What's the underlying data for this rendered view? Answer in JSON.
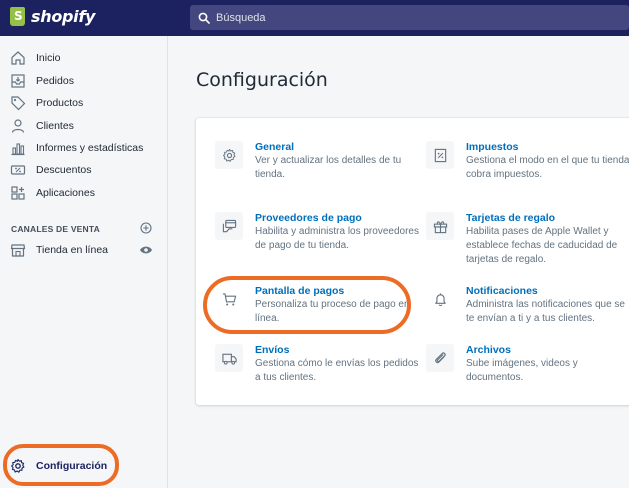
{
  "header": {
    "brand": "shopify",
    "search_placeholder": "Búsqueda"
  },
  "sidebar": {
    "items": [
      {
        "label": "Inicio",
        "icon": "home-icon"
      },
      {
        "label": "Pedidos",
        "icon": "orders-icon"
      },
      {
        "label": "Productos",
        "icon": "tag-icon"
      },
      {
        "label": "Clientes",
        "icon": "person-icon"
      },
      {
        "label": "Informes y estadísticas",
        "icon": "bar-chart-icon"
      },
      {
        "label": "Descuentos",
        "icon": "discount-icon"
      },
      {
        "label": "Aplicaciones",
        "icon": "apps-icon"
      }
    ],
    "sales_channels_heading": "CANALES DE VENTA",
    "sales_channels": [
      {
        "label": "Tienda en línea",
        "icon": "store-icon"
      }
    ],
    "settings_label": "Configuración"
  },
  "main": {
    "title": "Configuración",
    "settings": [
      {
        "title": "General",
        "desc": "Ver y actualizar los detalles de tu tienda.",
        "icon": "gear-icon"
      },
      {
        "title": "Impuestos",
        "desc": "Gestiona el modo en el que tu tienda cobra impuestos.",
        "icon": "taxes-icon"
      },
      {
        "title": "Proveedores de pago",
        "desc": "Habilita y administra los proveedores de pago de tu tienda.",
        "icon": "payment-icon"
      },
      {
        "title": "Tarjetas de regalo",
        "desc": "Habilita pases de Apple Wallet y establece fechas de caducidad de tarjetas de regalo.",
        "icon": "gift-icon"
      },
      {
        "title": "Pantalla de pagos",
        "desc": "Personaliza tu proceso de pago en línea.",
        "icon": "cart-icon"
      },
      {
        "title": "Notificaciones",
        "desc": "Administra las notificaciones que se te envían a ti y a tus clientes.",
        "icon": "bell-icon"
      },
      {
        "title": "Envíos",
        "desc": "Gestiona cómo le envías los pedidos a tus clientes.",
        "icon": "truck-icon"
      },
      {
        "title": "Archivos",
        "desc": "Sube imágenes, videos y documentos.",
        "icon": "paperclip-icon"
      }
    ]
  },
  "colors": {
    "topbar": "#1c2260",
    "link": "#006fbb",
    "highlight_ring": "#ec6c25"
  }
}
